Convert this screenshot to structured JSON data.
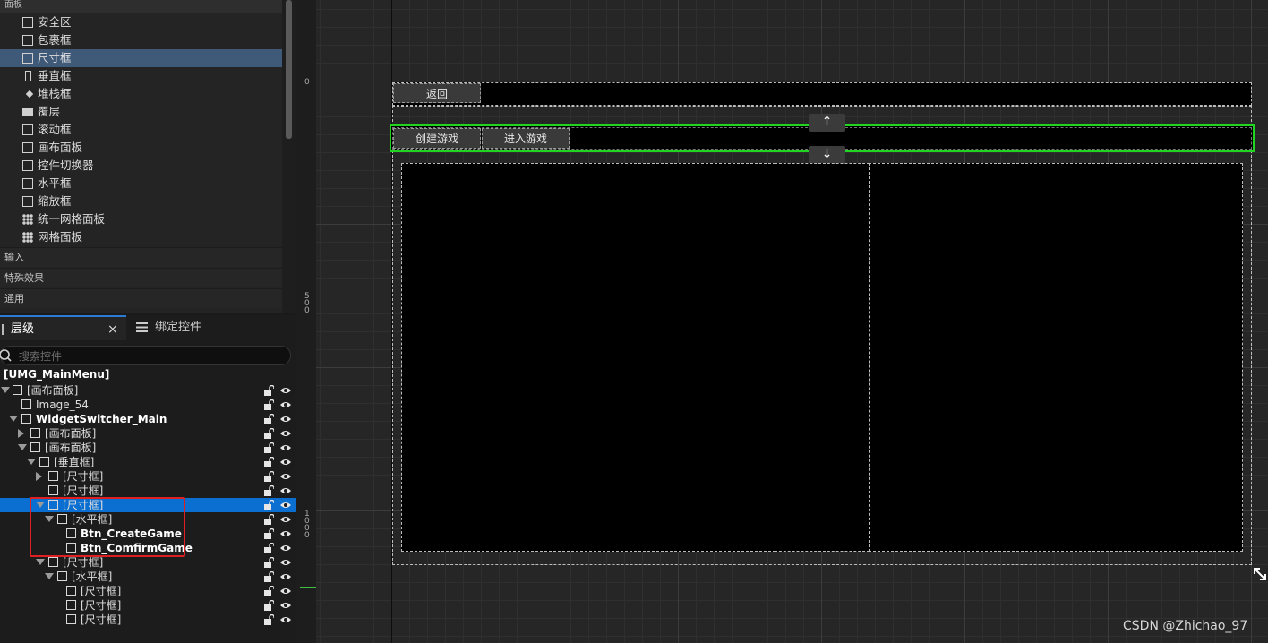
{
  "palette": {
    "top_category": "面板",
    "items": [
      {
        "label": "安全区",
        "icon": "safe-zone-icon"
      },
      {
        "label": "包裹框",
        "icon": "wrap-box-icon"
      },
      {
        "label": "尺寸框",
        "icon": "size-box-icon",
        "selected": true
      },
      {
        "label": "垂直框",
        "icon": "vertical-box-icon"
      },
      {
        "label": "堆栈框",
        "icon": "stack-box-icon"
      },
      {
        "label": "覆层",
        "icon": "overlay-icon"
      },
      {
        "label": "滚动框",
        "icon": "scroll-box-icon"
      },
      {
        "label": "画布面板",
        "icon": "canvas-panel-icon"
      },
      {
        "label": "控件切换器",
        "icon": "widget-switcher-icon"
      },
      {
        "label": "水平框",
        "icon": "horizontal-box-icon"
      },
      {
        "label": "缩放框",
        "icon": "scale-box-icon"
      },
      {
        "label": "统一网格面板",
        "icon": "uniform-grid-icon"
      },
      {
        "label": "网格面板",
        "icon": "grid-panel-icon"
      }
    ],
    "categories": [
      "输入",
      "特殊效果",
      "通用"
    ]
  },
  "hierarchy": {
    "tabs": [
      {
        "label": "层级",
        "close": "×"
      },
      {
        "label": "绑定控件"
      }
    ],
    "search_placeholder": "搜索控件",
    "root": "[UMG_MainMenu]",
    "rows": [
      {
        "label": "[画布面板]"
      },
      {
        "label": "Image_54"
      },
      {
        "label": "WidgetSwitcher_Main"
      },
      {
        "label": "[画布面板]"
      },
      {
        "label": "[画布面板]"
      },
      {
        "label": "[垂直框]"
      },
      {
        "label": "[尺寸框]"
      },
      {
        "label": "[尺寸框]"
      },
      {
        "label": "[尺寸框]",
        "selected": true
      },
      {
        "label": "[水平框]"
      },
      {
        "label": "Btn_CreateGame"
      },
      {
        "label": "Btn_ComfirmGame"
      },
      {
        "label": "[尺寸框]"
      },
      {
        "label": "[水平框]"
      },
      {
        "label": "[尺寸框]"
      },
      {
        "label": "[尺寸框]"
      },
      {
        "label": "[尺寸框]"
      }
    ]
  },
  "ruler": {
    "ticks": [
      "0",
      "5\n0\n0",
      "1\n0\n0\n0"
    ]
  },
  "designer": {
    "back_button": "返回",
    "create_game_button": "创建游戏",
    "enter_game_button": "进入游戏",
    "up_arrow": "↑",
    "down_arrow": "↓",
    "resize_handle": "resize-icon"
  },
  "colors": {
    "selection_blue": "#0a6fd1",
    "palette_selected": "#3f5a78",
    "highlight_green": "#22d422",
    "annotation_red": "#e02020"
  },
  "watermark": "CSDN @Zhichao_97"
}
